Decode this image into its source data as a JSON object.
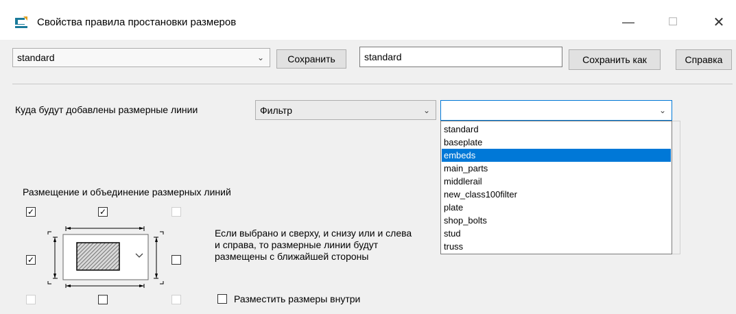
{
  "window": {
    "title": "Свойства правила простановки размеров",
    "minimize_glyph": "—",
    "maximize_glyph": "☐",
    "close_glyph": "✕"
  },
  "toolbar": {
    "preset_value": "standard",
    "save_label": "Сохранить",
    "name_value": "standard",
    "save_as_label": "Сохранить как",
    "help_label": "Справка"
  },
  "filter_section": {
    "label": "Куда будут добавлены размерные линии",
    "filter_combo_value": "Фильтр",
    "second_combo_value": "",
    "options": [
      "standard",
      "baseplate",
      "embeds",
      "main_parts",
      "middlerail",
      "new_class100filter",
      "plate",
      "shop_bolts",
      "stud",
      "truss"
    ],
    "selected_option": "embeds"
  },
  "placement": {
    "heading": "Размещение и объединение размерных линий",
    "info_line1": "Если выбрано и сверху, и снизу или и слева",
    "info_line2": "и справа, то размерные линии будут",
    "info_line3": "размещены с ближайшей стороны",
    "inside_label": "Разместить размеры внутри",
    "checkboxes": {
      "top_left": true,
      "top_center": true,
      "top_right": false,
      "middle_left": true,
      "middle_right": false,
      "bottom_left": false,
      "bottom_center": false,
      "bottom_right": false,
      "inside": false
    }
  },
  "colors": {
    "accent": "#0078d7",
    "icon_teal": "#1a7a9a"
  }
}
